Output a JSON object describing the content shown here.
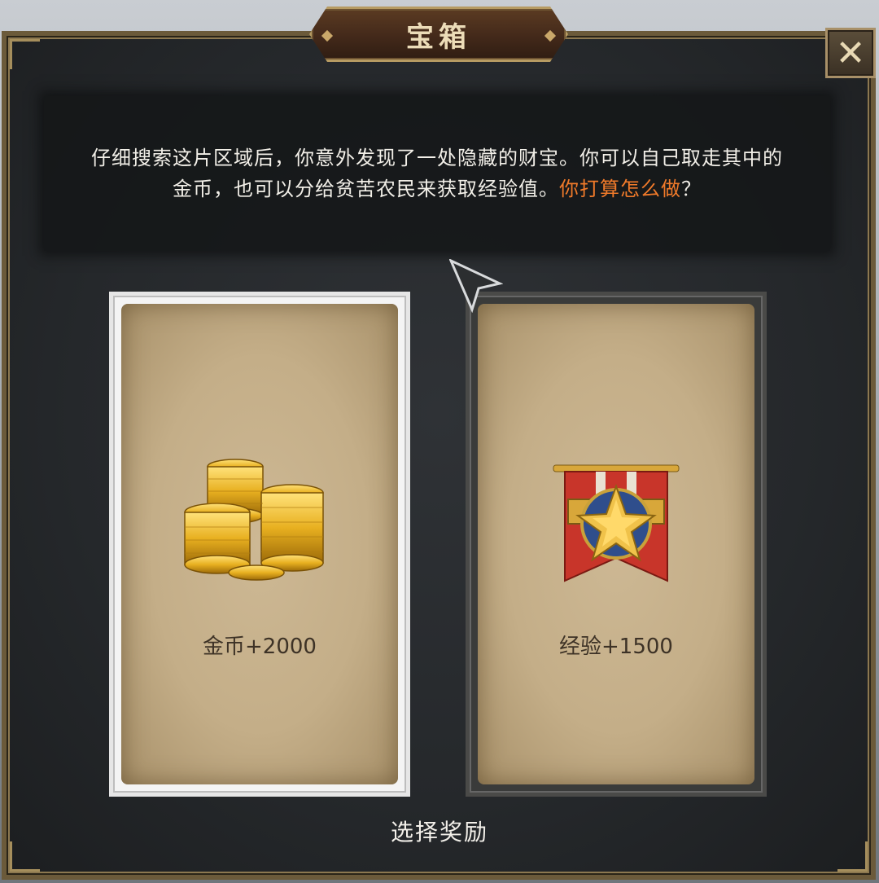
{
  "dialog": {
    "title": "宝箱",
    "close_label": "✕",
    "description": {
      "text_plain": "仔细搜索这片区域后，你意外发现了一处隐藏的财宝。你可以自己取走其中的金币，也可以分给贫苦农民来获取经验值。",
      "text_highlight": "你打算怎么做",
      "text_end": "？",
      "highlight_color": "#f07a2a"
    },
    "options": [
      {
        "label": "金币+2000",
        "icon": "gold-coins-icon",
        "selected": true
      },
      {
        "label": "经验+1500",
        "icon": "medal-banner-icon",
        "selected": false
      }
    ],
    "footer": "选择奖励"
  }
}
